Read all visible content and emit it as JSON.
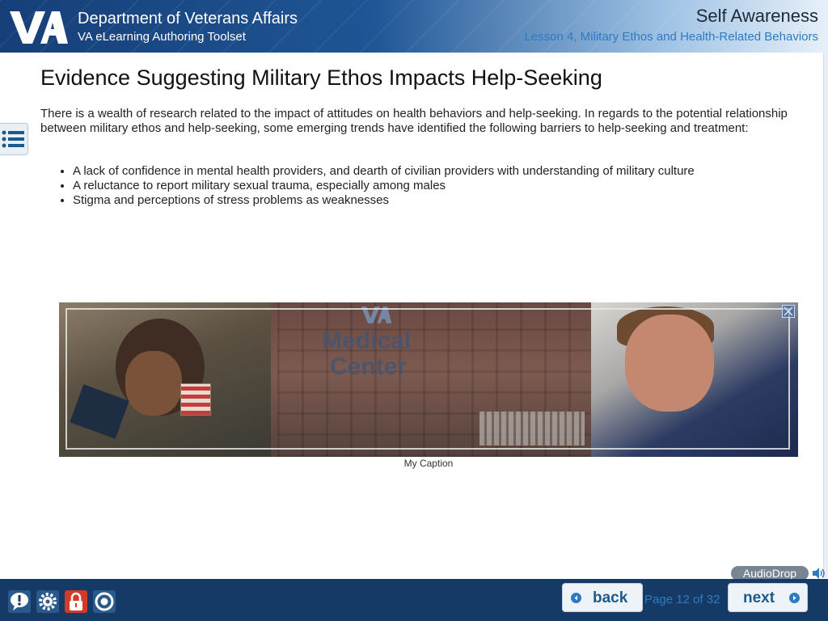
{
  "header": {
    "org_name": "Department of Veterans Affairs",
    "toolset": "VA eLearning Authoring Toolset",
    "course_title": "Self Awareness",
    "lesson_title": "Lesson 4, Military Ethos and Health-Related Behaviors"
  },
  "content": {
    "page_title": "Evidence Suggesting Military Ethos Impacts Help-Seeking",
    "intro": "There is a wealth of research related to the impact of attitudes on health behaviors and help-seeking. In regards to the potential relationship between military ethos and help-seeking, some emerging trends have identified the following barriers to help-seeking and treatment:",
    "bullets": [
      "A lack of confidence in mental health providers, and dearth of civilian providers with understanding of military culture",
      "A reluctance to report military sexual trauma, especially among males",
      "Stigma and perceptions of stress problems as weaknesses"
    ],
    "image": {
      "sign_line1": "Medical",
      "sign_line2": "Center",
      "caption": "My Caption"
    }
  },
  "audio": {
    "label": "AudioDrop"
  },
  "navigation": {
    "back_label": "back",
    "next_label": "next",
    "page_indicator": "Page 12 of 32"
  },
  "icons": {
    "menu": "list-icon",
    "help": "help-icon",
    "settings": "gear-icon",
    "lock": "lock-icon",
    "glossary": "circle-icon",
    "audio": "speaker-icon",
    "expand": "expand-icon"
  },
  "colors": {
    "accent": "#2f7ac0",
    "footer": "#163a66",
    "button_text": "#1d5a8c",
    "lock": "#d23a2a"
  }
}
